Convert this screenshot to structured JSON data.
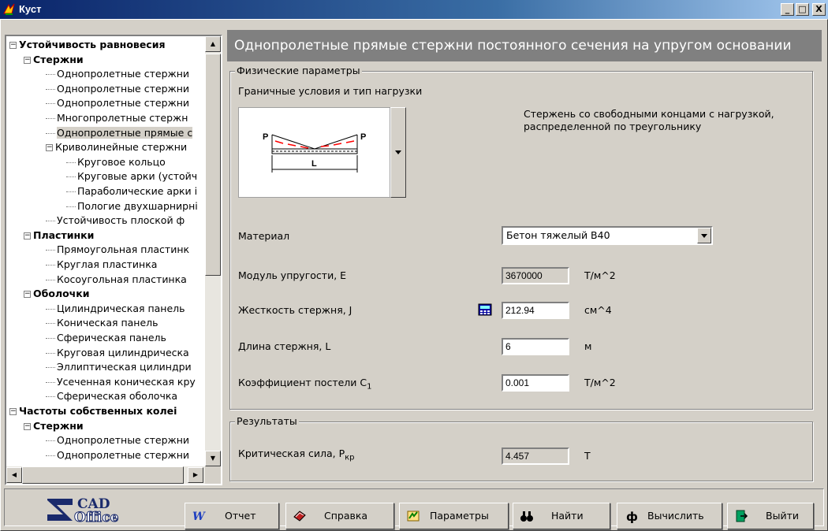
{
  "window": {
    "title": "Куст",
    "minimize": "_",
    "maximize": "□",
    "close": "X"
  },
  "tree": {
    "items": [
      {
        "label": "Устойчивость равновесия",
        "level": 0,
        "bold": true,
        "expander": "−"
      },
      {
        "label": "Стержни",
        "level": 1,
        "bold": true,
        "expander": "−"
      },
      {
        "label": "Однопролетные стержни",
        "level": 2
      },
      {
        "label": "Однопролетные стержни",
        "level": 2
      },
      {
        "label": "Однопролетные стержни",
        "level": 2
      },
      {
        "label": "Многопролетные стержн",
        "level": 2
      },
      {
        "label": "Однопролетные прямые с",
        "level": 2,
        "selected": true
      },
      {
        "label": "Криволинейные стержни",
        "level": 2,
        "expander": "−"
      },
      {
        "label": "Круговое кольцо",
        "level": 3
      },
      {
        "label": "Круговые арки (устойч",
        "level": 3
      },
      {
        "label": "Параболические арки i",
        "level": 3
      },
      {
        "label": "Пологие двухшарнирні",
        "level": 3
      },
      {
        "label": "Устойчивость плоской ф",
        "level": 2
      },
      {
        "label": "Пластинки",
        "level": 1,
        "bold": true,
        "expander": "−"
      },
      {
        "label": "Прямоугольная пластинк",
        "level": 2
      },
      {
        "label": "Круглая пластинка",
        "level": 2
      },
      {
        "label": "Косоугольная пластинка",
        "level": 2
      },
      {
        "label": "Оболочки",
        "level": 1,
        "bold": true,
        "expander": "−"
      },
      {
        "label": "Цилиндрическая панель",
        "level": 2
      },
      {
        "label": "Коническая панель",
        "level": 2
      },
      {
        "label": "Сферическая панель",
        "level": 2
      },
      {
        "label": "Круговая цилиндрическа",
        "level": 2
      },
      {
        "label": "Эллиптическая цилиндри",
        "level": 2
      },
      {
        "label": "Усеченная коническая кру",
        "level": 2
      },
      {
        "label": "Сферическая оболочка",
        "level": 2
      },
      {
        "label": "Частоты собственных колеі",
        "level": 0,
        "bold": true,
        "expander": "−"
      },
      {
        "label": "Стержни",
        "level": 1,
        "bold": true,
        "expander": "−"
      },
      {
        "label": "Однопролетные стержни",
        "level": 2
      },
      {
        "label": "Однопролетные стержни",
        "level": 2
      }
    ]
  },
  "header": {
    "title": "Однопролетные прямые стержни постоянного сечения на упругом основании"
  },
  "physical": {
    "group_title": "Физические параметры",
    "boundary_label": "Граничные условия и тип нагрузки",
    "diagram": {
      "load_left": "P",
      "load_right": "P",
      "length": "L"
    },
    "description": "Стержень со свободными концами с нагрузкой, распределенной по треугольнику",
    "material_label": "Материал",
    "material_value": "Бетон тяжелый В40",
    "modulus_label": "Модуль упругости, E",
    "modulus_value": "3670000",
    "modulus_unit": "Т/м^2",
    "stiffness_label": "Жесткость стержня, J",
    "stiffness_value": "212.94",
    "stiffness_unit": "см^4",
    "length_label": "Длина стержня, L",
    "length_value": "6",
    "length_unit": "м",
    "bedding_label": "Коэффициент постели C",
    "bedding_sub": "1",
    "bedding_value": "0.001",
    "bedding_unit": "Т/м^2"
  },
  "results": {
    "group_title": "Результаты",
    "critical_label": "Критическая сила, P",
    "critical_sub": "кр",
    "critical_value": "4.457",
    "critical_unit": "Т"
  },
  "logo": {
    "line1": "CAD",
    "line2": "Office"
  },
  "toolbar": {
    "report": "Отчет",
    "help": "Справка",
    "params": "Параметры",
    "find": "Найти",
    "compute": "Вычислить",
    "exit": "Выйти"
  },
  "colors": {
    "titlebar": "#0a246a",
    "header_band": "#808080",
    "face": "#d4d0c8",
    "load_arrow": "#ff0000"
  }
}
